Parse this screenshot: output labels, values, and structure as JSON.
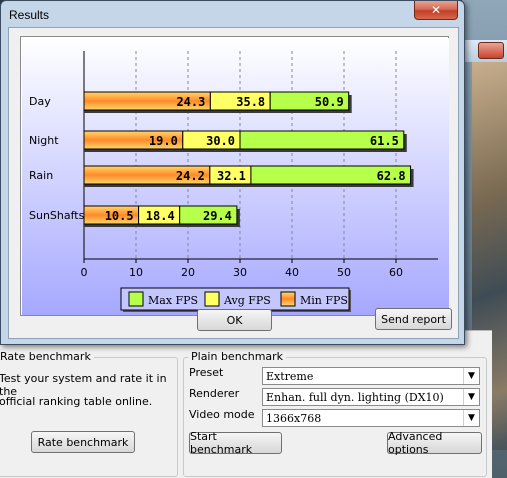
{
  "results_window": {
    "title": "Results",
    "close_glyph": "✕",
    "ok_label": "OK",
    "send_report_label": "Send report"
  },
  "chart_data": {
    "type": "bar",
    "orientation": "horizontal",
    "stacked": true,
    "categories": [
      "Day",
      "Night",
      "Rain",
      "SunShafts"
    ],
    "series": [
      {
        "name": "Min FPS",
        "values": [
          24.3,
          19.0,
          24.2,
          10.5
        ],
        "color": "#ff9a3a"
      },
      {
        "name": "Avg FPS",
        "values": [
          35.8,
          30.0,
          32.1,
          18.4
        ],
        "color": "#ffff66"
      },
      {
        "name": "Max FPS",
        "values": [
          50.9,
          61.5,
          62.8,
          29.4
        ],
        "color": "#b6ff4a"
      }
    ],
    "value_labels": [
      [
        "24.3",
        "35.8",
        "50.9"
      ],
      [
        "19.0",
        "30.0",
        "61.5"
      ],
      [
        "24.2",
        "32.1",
        "62.8"
      ],
      [
        "10.5",
        "18.4",
        "29.4"
      ]
    ],
    "xticks": [
      "0",
      "10",
      "20",
      "30",
      "40",
      "50",
      "60"
    ],
    "xlim": [
      0,
      68
    ],
    "grid": true,
    "legend_order": [
      "Max FPS",
      "Avg FPS",
      "Min FPS"
    ],
    "legend_placement": "bottom",
    "plot_background": "gradient white to lavender"
  },
  "benchmark_dialog": {
    "rate_group": {
      "title": "Rate benchmark",
      "description_line1": "Test your system and rate it in the",
      "description_line2": "official ranking table online.",
      "button_label": "Rate benchmark"
    },
    "plain_group": {
      "title": "Plain benchmark",
      "preset_label": "Preset",
      "preset_value": "Extreme",
      "renderer_label": "Renderer",
      "renderer_value": "Enhan. full dyn. lighting (DX10)",
      "video_mode_label": "Video mode",
      "video_mode_value": "1366x768",
      "start_label": "Start benchmark",
      "advanced_label": "Advanced options"
    }
  }
}
